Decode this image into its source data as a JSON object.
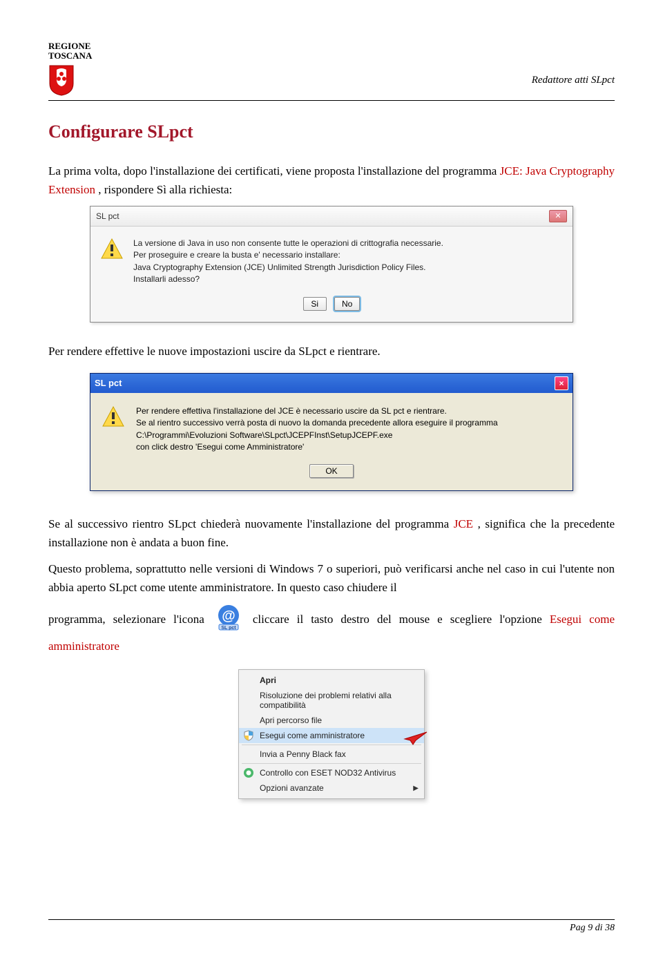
{
  "header": {
    "org_line1": "REGIONE",
    "org_line2": "TOSCANA",
    "doc_title": "Redattore atti SLpct"
  },
  "title": "Configurare SLpct",
  "para1_a": "La prima volta, dopo l'installazione dei certificati, viene proposta l'installazione del programma ",
  "para1_b": "JCE: Java Cryptography Extension",
  "para1_c": ", rispondere Sì alla richiesta:",
  "dialog1": {
    "title": "SL pct",
    "line1": "La versione di Java in uso non consente tutte le operazioni di crittografia necessarie.",
    "line2": "Per proseguire e creare la busta e' necessario installare:",
    "line3": "Java Cryptography Extension (JCE) Unlimited Strength Jurisdiction Policy Files.",
    "line4": "Installarli adesso?",
    "btn_yes": "Si",
    "btn_no": "No"
  },
  "para2": "Per rendere effettive le nuove impostazioni uscire da SLpct e rientrare.",
  "dialog2": {
    "title": "SL pct",
    "line1": "Per rendere effettiva l'installazione del JCE è necessario uscire da SL pct e rientrare.",
    "line2": "Se al rientro successivo verrà posta di nuovo la domanda precedente allora eseguire il programma",
    "line3": "C:\\Programmi\\Evoluzioni Software\\SLpct\\JCEPFInst\\SetupJCEPF.exe",
    "line4": "con click destro 'Esegui come Amministratore'",
    "btn_ok": "OK"
  },
  "para3_a": "Se al successivo rientro SLpct chiederà nuovamente l'installazione del programma ",
  "para3_b": "JCE",
  "para3_c": ", significa che la precedente installazione non è andata a buon fine.",
  "para4": "Questo problema, soprattutto nelle versioni di Windows 7 o superiori, può verificarsi anche nel caso in cui l'utente non abbia aperto SLpct come utente amministratore. In questo caso chiudere il",
  "para5_a": "programma, selezionare l'icona ",
  "para5_b": " cliccare il tasto destro del mouse e scegliere l'opzione ",
  "para5_c": "Esegui come amministratore",
  "context_menu": {
    "open": "Apri",
    "compat": "Risoluzione dei problemi relativi alla compatibilità",
    "openloc": "Apri percorso file",
    "runas": "Esegui come amministratore",
    "sendfax": "Invia a Penny Black fax",
    "eset": "Controllo con ESET NOD32 Antivirus",
    "advanced": "Opzioni avanzate"
  },
  "footer": "Pag 9 di 38"
}
